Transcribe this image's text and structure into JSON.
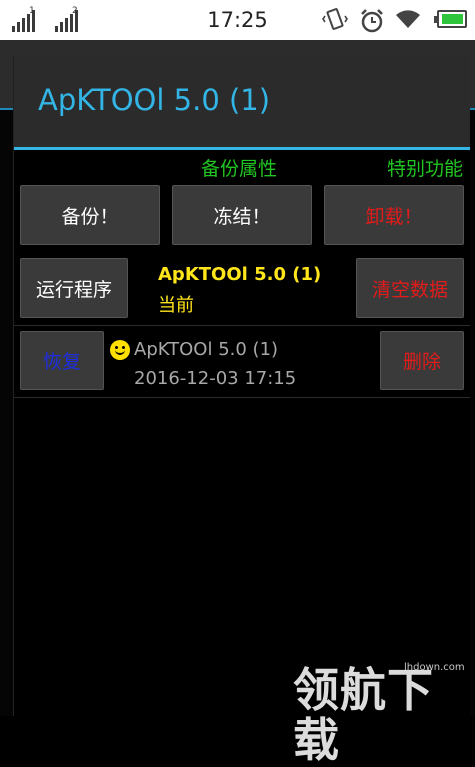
{
  "status_bar": {
    "time": "17:25",
    "sim1_label": "1",
    "sim2_label": "2",
    "icons": [
      "signal-sim1-icon",
      "signal-sim2-icon",
      "vibrate-icon",
      "alarm-icon",
      "wifi-icon",
      "battery-icon"
    ]
  },
  "dialog": {
    "title": "ApKTOOl 5.0 (1)",
    "section_backup_props": "备份属性",
    "section_special": "特别功能",
    "buttons": {
      "backup": "备份！",
      "freeze": "冻结！",
      "uninstall": "卸载！",
      "run": "运行程序",
      "clear_data": "清空数据",
      "restore": "恢复",
      "delete": "删除"
    },
    "current_app": {
      "name": "ApKTOOl 5.0 (1)",
      "state": "当前"
    },
    "backup_entry": {
      "name": "ApKTOOl 5.0 (1)",
      "date": "2016-12-03 17:15"
    }
  },
  "watermark": {
    "url": "lhdown.com",
    "text": "领航下载"
  },
  "colors": {
    "accent": "#33b5e5",
    "green_label": "#21c521",
    "warning_red": "#e21b1b",
    "restore_blue": "#1d2fe0",
    "app_yellow": "#ffe51a"
  }
}
